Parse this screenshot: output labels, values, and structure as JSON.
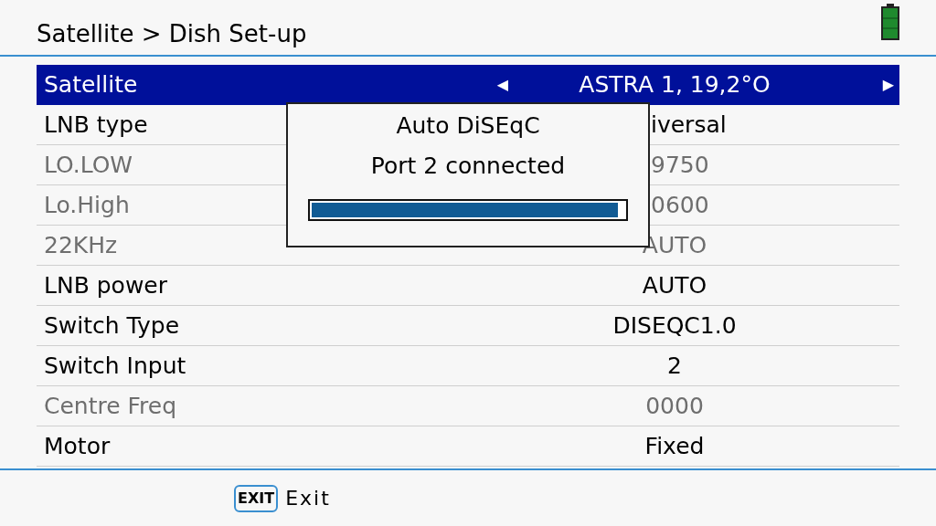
{
  "header": {
    "title": "Satellite > Dish Set-up"
  },
  "rows": [
    {
      "label": "Satellite",
      "value": "ASTRA 1, 19,2°O",
      "selected": true,
      "disabled": false,
      "left_arrow": "◀",
      "right_arrow": "▶"
    },
    {
      "label": "LNB type",
      "value": "iversal",
      "selected": false,
      "disabled": false,
      "cut": true
    },
    {
      "label": "LO.LOW",
      "value": "9750",
      "selected": false,
      "disabled": true,
      "cut": true
    },
    {
      "label": "Lo.High",
      "value": "0600",
      "selected": false,
      "disabled": true,
      "cut": true
    },
    {
      "label": "22KHz",
      "value": "AUTO",
      "selected": false,
      "disabled": true
    },
    {
      "label": "LNB power",
      "value": "AUTO",
      "selected": false,
      "disabled": false
    },
    {
      "label": "Switch Type",
      "value": "DISEQC1.0",
      "selected": false,
      "disabled": false
    },
    {
      "label": "Switch Input",
      "value": "2",
      "selected": false,
      "disabled": false
    },
    {
      "label": "Centre Freq",
      "value": "0000",
      "selected": false,
      "disabled": true
    },
    {
      "label": "Motor",
      "value": "Fixed",
      "selected": false,
      "disabled": false
    }
  ],
  "dialog": {
    "title": "Auto DiSEqC",
    "message": "Port 2 connected",
    "progress": {
      "level": 0.98
    }
  },
  "footer": {
    "key": "EXIT",
    "label": "Exit"
  }
}
